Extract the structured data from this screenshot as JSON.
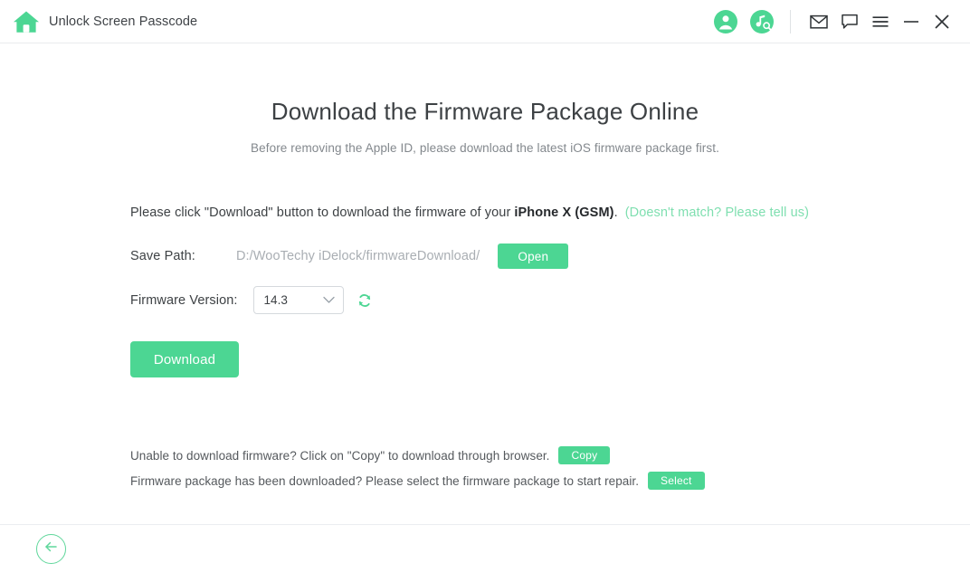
{
  "titlebar": {
    "app_title": "Unlock Screen Passcode",
    "home_icon": "home-icon",
    "account_icon": "account-icon",
    "music-search_icon": "music-search-icon",
    "mail_icon": "mail-icon",
    "feedback_icon": "feedback-icon",
    "menu_icon": "hamburger-menu-icon",
    "minimize_icon": "minimize-icon",
    "close_icon": "close-icon"
  },
  "main": {
    "page_title": "Download the Firmware Package Online",
    "page_subtitle": "Before removing the Apple ID, please download the latest iOS firmware package first.",
    "instruction_prefix": "Please click \"Download\" button to download the firmware of your",
    "device_model": "iPhone X (GSM)",
    "instruction_suffix": ".",
    "mismatch_link": "(Doesn't match? Please tell us)",
    "save_path_label": "Save Path:",
    "save_path_value": "D:/WooTechy iDelock/firmwareDownload/",
    "open_button": "Open",
    "firmware_version_label": "Firmware Version:",
    "firmware_version_value": "14.3",
    "refresh_icon": "refresh-icon",
    "download_button": "Download"
  },
  "helpers": {
    "copy_text": "Unable to download firmware? Click on \"Copy\" to download through browser.",
    "copy_button": "Copy",
    "select_text": "Firmware package has been downloaded? Please select the firmware package to start repair.",
    "select_button": "Select"
  },
  "footer": {
    "back_icon": "arrow-left-icon"
  },
  "colors": {
    "accent_green": "#4cd693",
    "link_green": "#7fdfb0",
    "text_dark": "#3d4144",
    "text_muted": "#83888d",
    "placeholder_gray": "#a9aeb3",
    "border_gray": "#e9ebee"
  }
}
